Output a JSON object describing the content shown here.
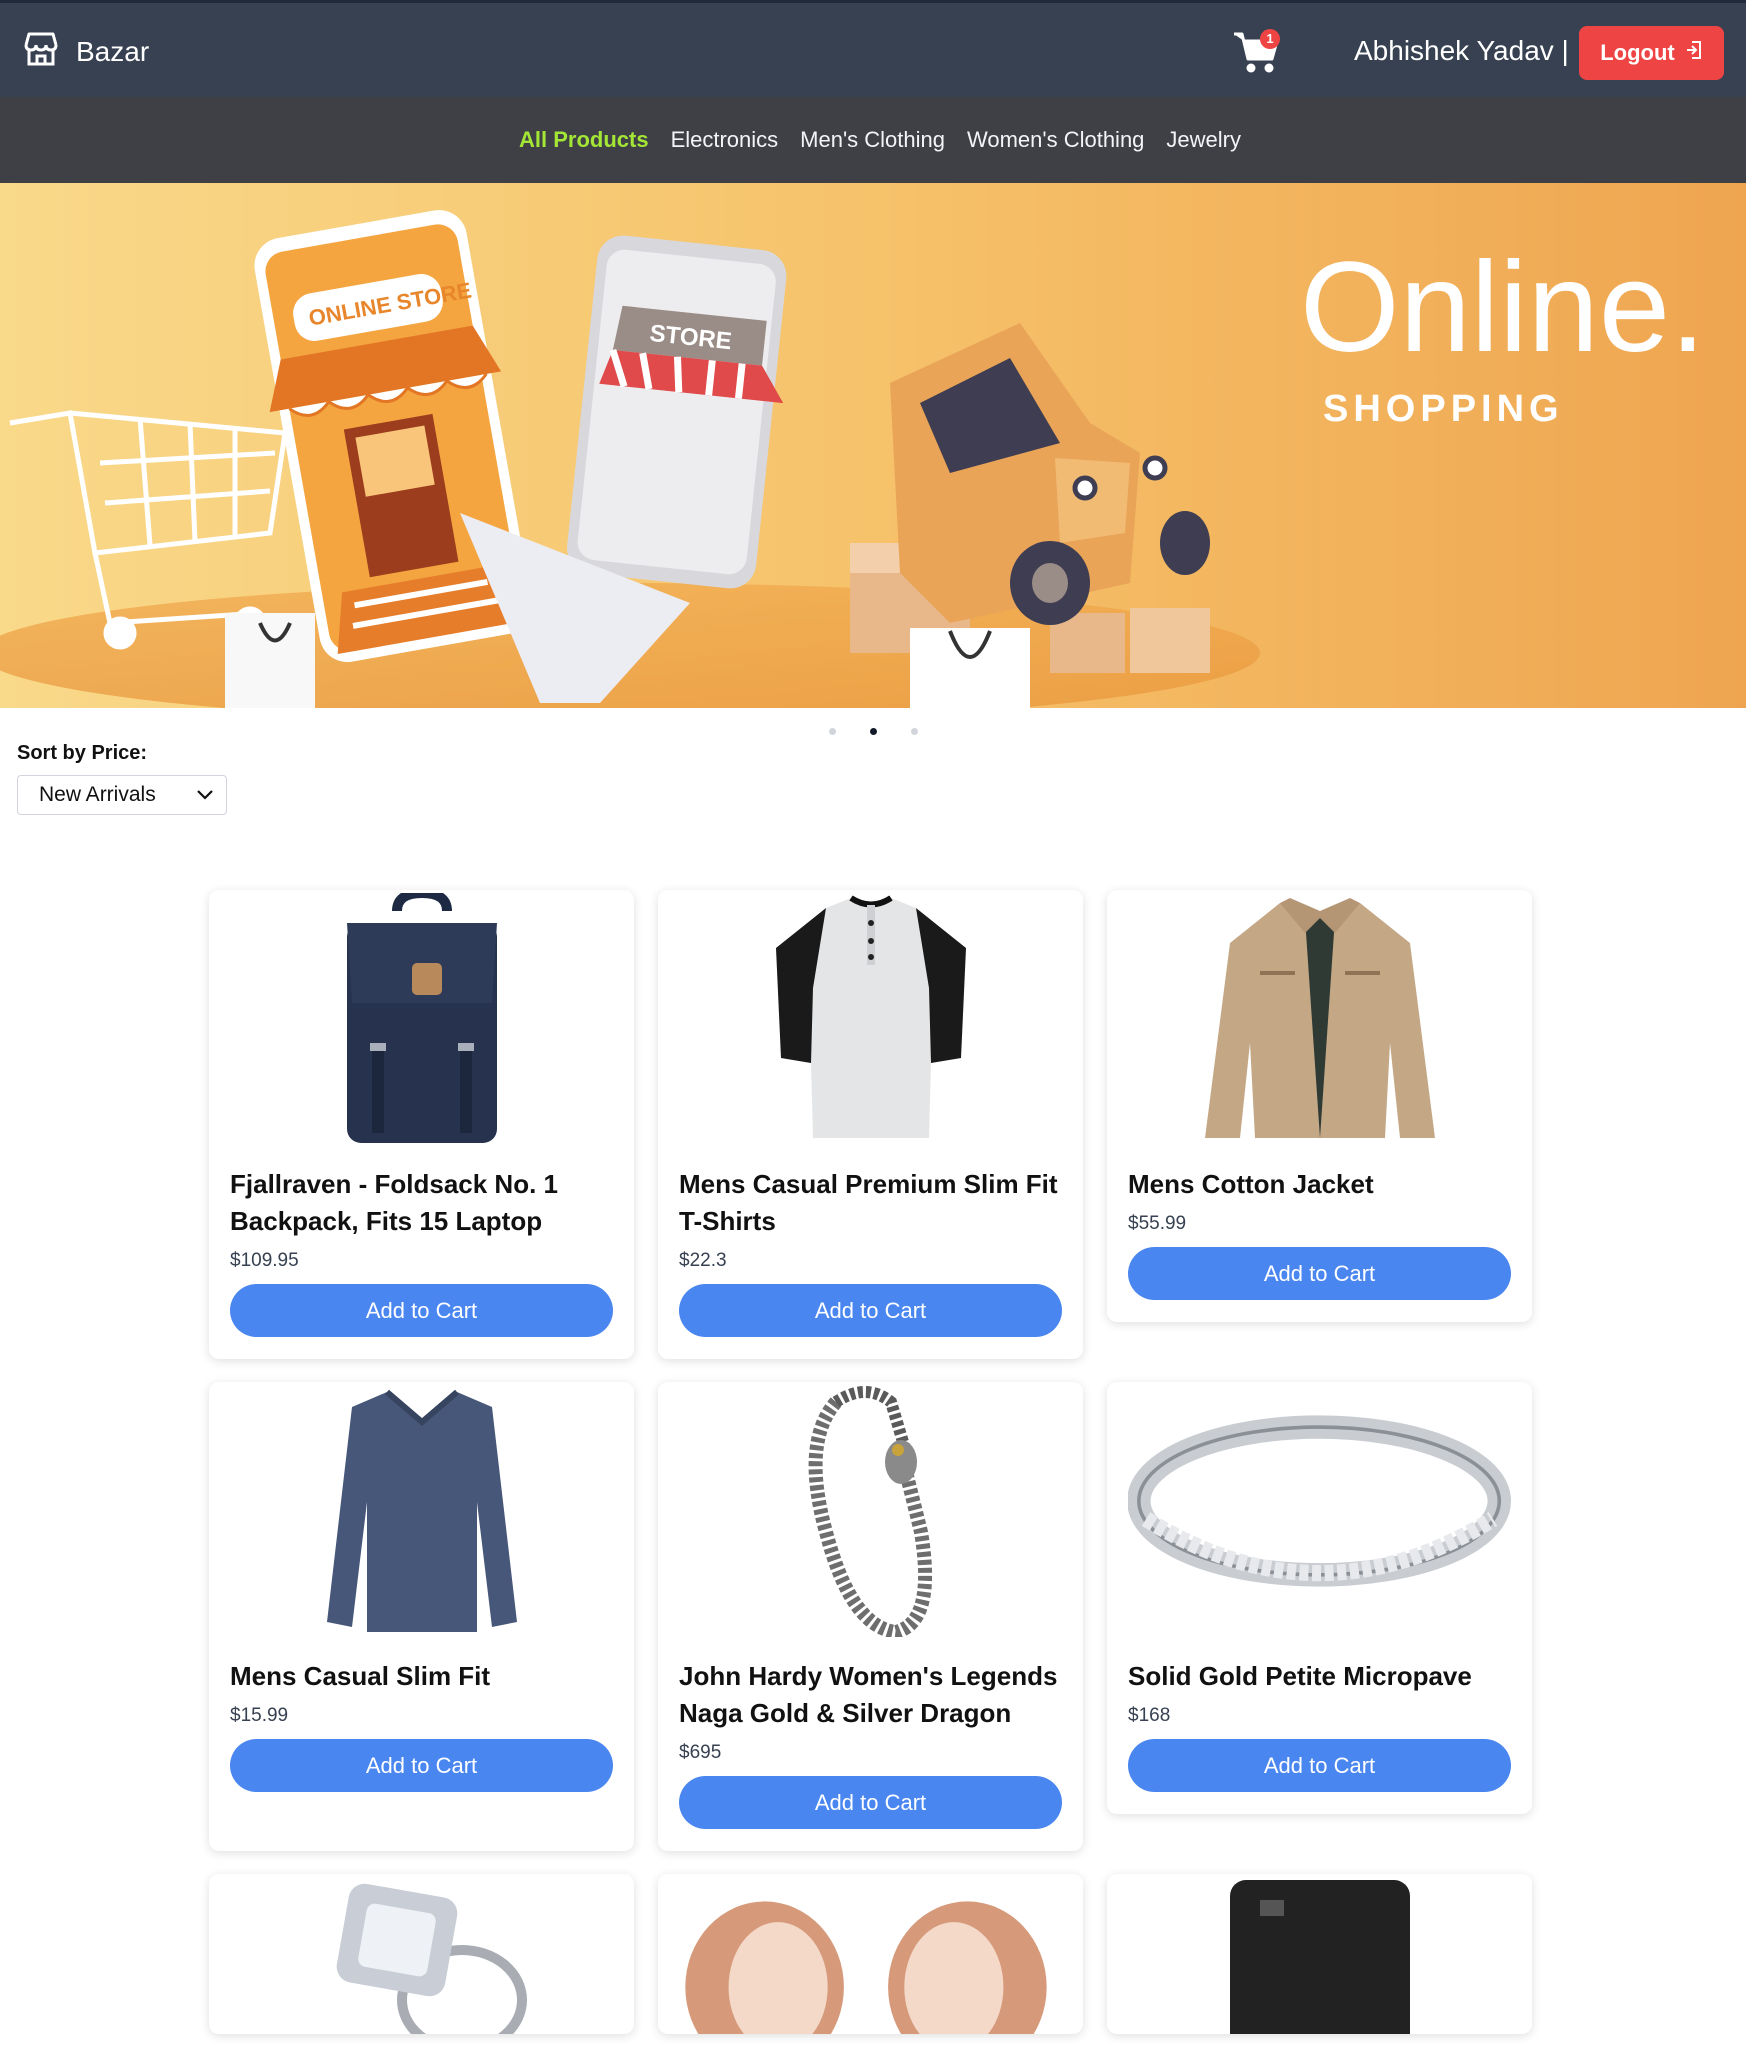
{
  "header": {
    "brand": "Bazar",
    "cart_count": "1",
    "username": "Abhishek Yadav |",
    "logout_label": "Logout",
    "icons": [
      "store-icon",
      "cart-icon",
      "logout-icon"
    ]
  },
  "nav": {
    "items": [
      {
        "label": "All Products",
        "active": true
      },
      {
        "label": "Electronics"
      },
      {
        "label": "Men's Clothing"
      },
      {
        "label": "Women's Clothing"
      },
      {
        "label": "Jewelry"
      }
    ]
  },
  "banner": {
    "headline": "Online.",
    "subheadline": "SHOPPING",
    "store_sign": "ONLINE STORE",
    "phone_sign": "STORE",
    "slide_index": 2,
    "slide_count": 3
  },
  "sort": {
    "label": "Sort by Price:",
    "selected": "New Arrivals"
  },
  "products": [
    {
      "title": "Fjallraven - Foldsack No. 1 Backpack, Fits 15 Laptop",
      "price": "$109.95",
      "button": "Add to Cart",
      "image": "backpack"
    },
    {
      "title": "Mens Casual Premium Slim Fit T-Shirts",
      "price": "$22.3",
      "button": "Add to Cart",
      "image": "tshirt"
    },
    {
      "title": "Mens Cotton Jacket",
      "price": "$55.99",
      "button": "Add to Cart",
      "image": "jacket"
    },
    {
      "title": "Mens Casual Slim Fit",
      "price": "$15.99",
      "button": "Add to Cart",
      "image": "longsleeve"
    },
    {
      "title": "John Hardy Women's Legends Naga Gold & Silver Dragon",
      "price": "$695",
      "button": "Add to Cart",
      "image": "bracelet"
    },
    {
      "title": "Solid Gold Petite Micropave",
      "price": "$168",
      "button": "Add to Cart",
      "image": "ring"
    }
  ],
  "partial_products": [
    {
      "image": "diamond-ring"
    },
    {
      "image": "rose-gold-plugs"
    },
    {
      "image": "external-hard-drive"
    }
  ],
  "colors": {
    "topbar": "#374151",
    "catnav": "#3f3f46",
    "active_nav": "#a3e635",
    "logout": "#ef4444",
    "button": "#4a86f0",
    "banner": "#f3b45a"
  }
}
